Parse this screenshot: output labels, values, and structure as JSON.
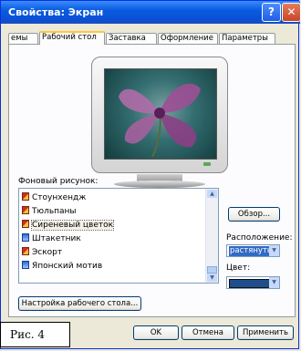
{
  "window": {
    "title": "Свойства: Экран"
  },
  "titlebar_buttons": {
    "help": "?",
    "close": "✕"
  },
  "tabs": [
    {
      "label": "емы"
    },
    {
      "label": "Рабочий стол"
    },
    {
      "label": "Заставка"
    },
    {
      "label": "Оформление"
    },
    {
      "label": "Параметры"
    }
  ],
  "background": {
    "label": "Фоновый рисунок:",
    "items": [
      {
        "label": "Стоунхендж",
        "icon": "bitmap-icon"
      },
      {
        "label": "Тюльпаны",
        "icon": "bitmap-icon"
      },
      {
        "label": "Сиреневый цветок",
        "icon": "bitmap-icon"
      },
      {
        "label": "Штакетник",
        "icon": "html-icon"
      },
      {
        "label": "Эскорт",
        "icon": "bitmap-icon"
      },
      {
        "label": "Японский мотив",
        "icon": "html-icon"
      }
    ],
    "browse_button": "Обзор..."
  },
  "position": {
    "label": "Расположение:",
    "value": "растянуть"
  },
  "color": {
    "label": "Цвет:",
    "value": "#1f4e8c"
  },
  "customize_button": "Настройка рабочего стола...",
  "buttons": {
    "ok": "OK",
    "cancel": "Отмена",
    "apply": "Применить"
  },
  "figure_caption": "Рис. 4"
}
